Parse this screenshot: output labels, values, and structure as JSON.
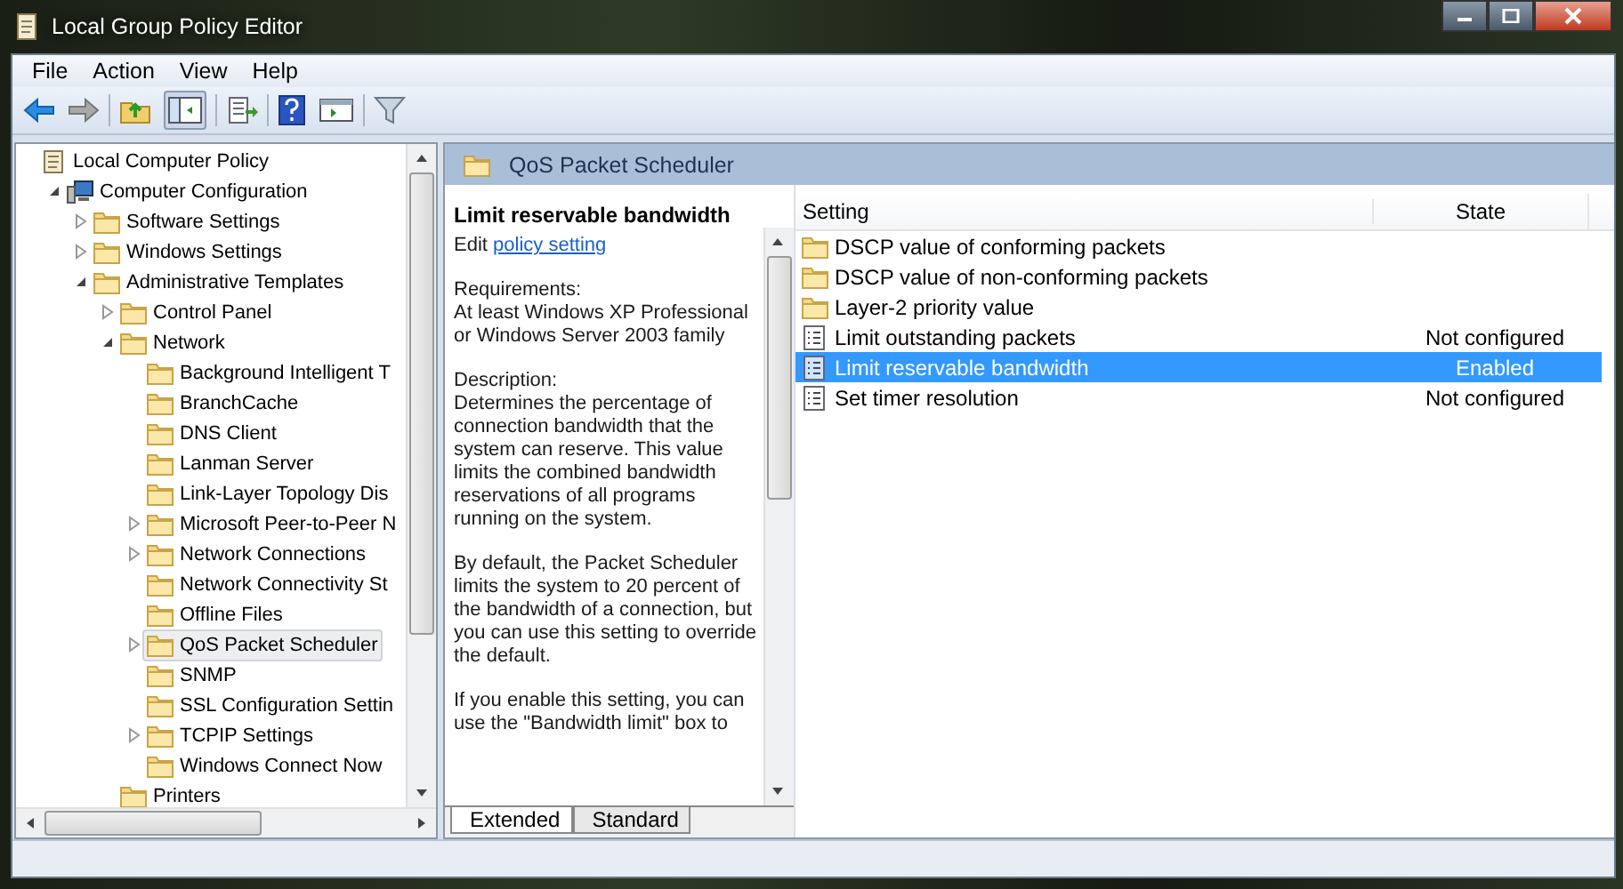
{
  "window": {
    "title": "Local Group Policy Editor"
  },
  "menu": [
    "File",
    "Action",
    "View",
    "Help"
  ],
  "tree": [
    {
      "label": "Local Computer Policy",
      "kind": "policy",
      "selected": false,
      "children": [
        {
          "label": "Computer Configuration",
          "kind": "computer",
          "selected": false,
          "expanded": true,
          "children": [
            {
              "label": "Software Settings",
              "kind": "folder",
              "selected": false,
              "expanded": false
            },
            {
              "label": "Windows Settings",
              "kind": "folder",
              "selected": false,
              "expanded": false
            },
            {
              "label": "Administrative Templates",
              "kind": "folder",
              "selected": false,
              "expanded": true,
              "children": [
                {
                  "label": "Control Panel",
                  "kind": "folder",
                  "selected": false,
                  "expanded": false
                },
                {
                  "label": "Network",
                  "kind": "folder",
                  "selected": false,
                  "expanded": true,
                  "children": [
                    {
                      "label": "Background Intelligent T",
                      "kind": "folder",
                      "selected": false
                    },
                    {
                      "label": "BranchCache",
                      "kind": "folder",
                      "selected": false
                    },
                    {
                      "label": "DNS Client",
                      "kind": "folder",
                      "selected": false
                    },
                    {
                      "label": "Lanman Server",
                      "kind": "folder",
                      "selected": false
                    },
                    {
                      "label": "Link-Layer Topology Dis",
                      "kind": "folder",
                      "selected": false
                    },
                    {
                      "label": "Microsoft Peer-to-Peer N",
                      "kind": "folder",
                      "selected": false,
                      "expanded": false
                    },
                    {
                      "label": "Network Connections",
                      "kind": "folder",
                      "selected": false,
                      "expanded": false
                    },
                    {
                      "label": "Network Connectivity St",
                      "kind": "folder",
                      "selected": false
                    },
                    {
                      "label": "Offline Files",
                      "kind": "folder",
                      "selected": false
                    },
                    {
                      "label": "QoS Packet Scheduler",
                      "kind": "folder",
                      "selected": true,
                      "expanded": false
                    },
                    {
                      "label": "SNMP",
                      "kind": "folder",
                      "selected": false
                    },
                    {
                      "label": "SSL Configuration Settin",
                      "kind": "folder",
                      "selected": false
                    },
                    {
                      "label": "TCPIP Settings",
                      "kind": "folder",
                      "selected": false,
                      "expanded": false
                    },
                    {
                      "label": "Windows Connect Now",
                      "kind": "folder",
                      "selected": false
                    }
                  ]
                },
                {
                  "label": "Printers",
                  "kind": "folder",
                  "selected": false
                }
              ]
            }
          ]
        }
      ]
    }
  ],
  "pane_title": "QoS Packet Scheduler",
  "description": {
    "title": "Limit reservable bandwidth",
    "edit_prefix": "Edit",
    "edit_link": "policy setting",
    "paragraphs": [
      [
        "Requirements:",
        "At least Windows XP Professional or Windows Server 2003 family"
      ],
      [
        "Description:",
        "Determines the percentage of connection bandwidth that the system can reserve. This value limits the combined bandwidth reservations of all programs running on the system."
      ],
      [
        "By default, the Packet Scheduler limits the system to 20 percent of the bandwidth of a connection, but you can use this setting to override the default."
      ],
      [
        "If you enable this setting, you can use the \"Bandwidth limit\" box to"
      ]
    ]
  },
  "columns": [
    "Setting",
    "State"
  ],
  "rows": [
    {
      "kind": "folder",
      "name": "DSCP value of conforming packets",
      "selected": false
    },
    {
      "kind": "folder",
      "name": "DSCP value of non-conforming packets",
      "selected": false
    },
    {
      "kind": "folder",
      "name": "Layer-2 priority value",
      "selected": false
    },
    {
      "kind": "setting",
      "name": "Limit outstanding packets",
      "state": "Not configured",
      "selected": false
    },
    {
      "kind": "setting",
      "name": "Limit reservable bandwidth",
      "state": "Enabled",
      "selected": true
    },
    {
      "kind": "setting",
      "name": "Set timer resolution",
      "state": "Not configured",
      "selected": false
    }
  ],
  "view_tabs": [
    {
      "label": "Extended",
      "selected": true
    },
    {
      "label": "Standard",
      "selected": false
    }
  ]
}
